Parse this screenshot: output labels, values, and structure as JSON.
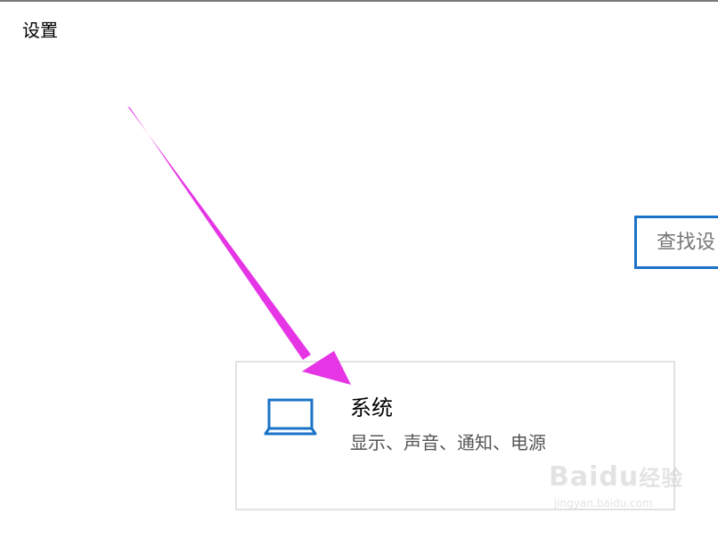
{
  "header": {
    "title": "设置"
  },
  "search": {
    "placeholder": "查找设"
  },
  "tiles": [
    {
      "icon": "laptop-icon",
      "title": "系统",
      "description": "显示、声音、通知、电源"
    }
  ],
  "annotation": {
    "arrow_color": "#e535e5"
  },
  "watermark": {
    "logo_text": "Baidu",
    "logo_suffix": "经验",
    "url": "jingyan.baidu.com"
  },
  "colors": {
    "accent": "#1a73c7",
    "tile_border": "#e2e2e2",
    "arrow": "#e535e5"
  }
}
